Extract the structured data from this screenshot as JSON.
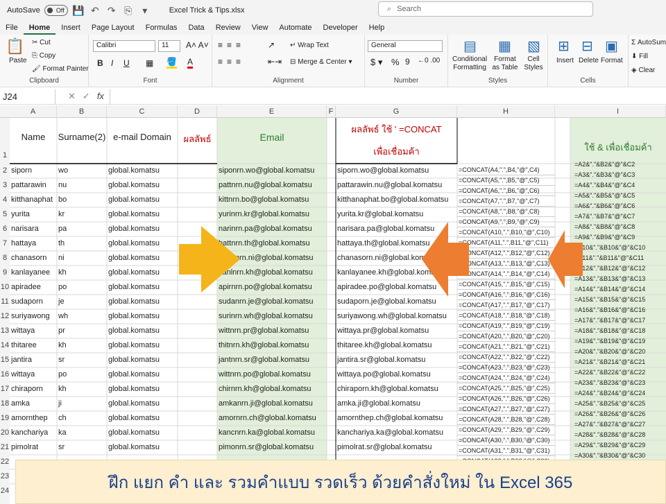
{
  "app": {
    "autosave_label": "AutoSave",
    "autosave_state": "Off",
    "filename": "Excel Trick & Tips.xlsx",
    "search_placeholder": "Search"
  },
  "tabs": [
    "File",
    "Home",
    "Insert",
    "Page Layout",
    "Formulas",
    "Data",
    "Review",
    "View",
    "Automate",
    "Developer",
    "Help"
  ],
  "ribbon": {
    "clipboard": {
      "label": "Clipboard",
      "paste": "Paste",
      "cut": "Cut",
      "copy": "Copy",
      "format_painter": "Format Painter"
    },
    "font": {
      "label": "Font",
      "name": "Calibri",
      "size": "11"
    },
    "alignment": {
      "label": "Alignment",
      "wrap": "Wrap Text",
      "merge": "Merge & Center"
    },
    "number": {
      "label": "Number",
      "format": "General"
    },
    "styles": {
      "label": "Styles",
      "cond": "Conditional Formatting",
      "table": "Format as Table",
      "cell": "Cell Styles"
    },
    "cells": {
      "label": "Cells",
      "insert": "Insert",
      "delete": "Delete",
      "format": "Format"
    },
    "editing": {
      "autosum": "AutoSum",
      "fill": "Fill",
      "clear": "Clear"
    }
  },
  "formula_bar": {
    "name_box": "J24",
    "fx": "fx"
  },
  "columns": [
    "A",
    "B",
    "C",
    "D",
    "E",
    "F",
    "G",
    "H",
    "I"
  ],
  "headers": {
    "a": "Name",
    "b": "Surname(2)",
    "c": "e-mail Domain",
    "d": "ผลลัพธ์",
    "e": "Email",
    "g1": "ผลลัพธ์ ใช้ ' =CONCAT",
    "g2": "เพื่อเชื่อมค้า",
    "i": "ใช้ & เพื่อเชื่อมค้า"
  },
  "rows": [
    {
      "n": "2",
      "a": "siporn",
      "b": "wo",
      "c": "global.komatsu",
      "e": "siponrn.wo@global.komatsu",
      "g": "siporn.wo@global.komatsu",
      "h": "=CONCAT(A4,\".\",B4,\"@\",C4)",
      "i": "=A2&\".\"&B2&\"@\"&C2"
    },
    {
      "n": "3",
      "a": "pattarawin",
      "b": "nu",
      "c": "global.komatsu",
      "e": "pattnrn.nu@global.komatsu",
      "g": "pattarawin.nu@global.komatsu",
      "h": "=CONCAT(A5,\".\",B5,\"@\",C5)",
      "i": "=A3&\".\"&B3&\"@\"&C3"
    },
    {
      "n": "4",
      "a": "kitthanaphat",
      "b": "bo",
      "c": "global.komatsu",
      "e": "kittnrn.bo@global.komatsu",
      "g": "kitthanaphat.bo@global.komatsu",
      "h": "=CONCAT(A6,\".\",B6,\"@\",C6)",
      "i": "=A4&\".\"&B4&\"@\"&C4"
    },
    {
      "n": "5",
      "a": "yurita",
      "b": "kr",
      "c": "global.komatsu",
      "e": "yurinrn.kr@global.komatsu",
      "g": "yurita.kr@global.komatsu",
      "h": "=CONCAT(A7,\".\",B7,\"@\",C7)",
      "i": "=A5&\".\"&B5&\"@\"&C5"
    },
    {
      "n": "6",
      "a": "narisara",
      "b": "pa",
      "c": "global.komatsu",
      "e": "narinrn.pa@global.komatsu",
      "g": "narisara.pa@global.komatsu",
      "h": "=CONCAT(A8,\".\",B8,\"@\",C8)",
      "i": "=A6&\".\"&B6&\"@\"&C6"
    },
    {
      "n": "7",
      "a": "hattaya",
      "b": "th",
      "c": "global.komatsu",
      "e": "hattnrn.th@global.komatsu",
      "g": "hattaya.th@global.komatsu",
      "h": "=CONCAT(A9,\".\",B9,\"@\",C9)",
      "i": "=A7&\".\"&B7&\"@\"&C7"
    },
    {
      "n": "8",
      "a": "chanasorn",
      "b": "ni",
      "c": "global.komatsu",
      "e": "channrn.ni@global.komatsu",
      "g": "chanasorn.ni@global.komatsu",
      "h": "=CONCAT(A10,\".\",B10,\"@\",C10)",
      "i": "=A8&\".\"&B8&\"@\"&C8"
    },
    {
      "n": "9",
      "a": "kanlayanee",
      "b": "kh",
      "c": "global.komatsu",
      "e": "kanlnrn.kh@global.komatsu",
      "g": "kanlayanee.kh@global.komatsu",
      "h": "=CONCAT(A11,\".\",B11,\"@\",C11)",
      "i": "=A9&\".\"&B9&\"@\"&C9"
    },
    {
      "n": "10",
      "a": "apiradee",
      "b": "po",
      "c": "global.komatsu",
      "e": "apirnrn.po@global.komatsu",
      "g": "apiradee.po@global.komatsu",
      "h": "=CONCAT(A12,\".\",B12,\"@\",C12)",
      "i": "=A10&\".\"&B10&\"@\"&C10"
    },
    {
      "n": "11",
      "a": "sudaporn",
      "b": "je",
      "c": "global.komatsu",
      "e": "sudanrn.je@global.komatsu",
      "g": "sudaporn.je@global.komatsu",
      "h": "=CONCAT(A13,\".\",B13,\"@\",C13)",
      "i": "=A11&\".\"&B11&\"@\"&C11"
    },
    {
      "n": "12",
      "a": "suriyawong",
      "b": "wh",
      "c": "global.komatsu",
      "e": "surinrn.wh@global.komatsu",
      "g": "suriyawong.wh@global.komatsu",
      "h": "=CONCAT(A14,\".\",B14,\"@\",C14)",
      "i": "=A12&\".\"&B12&\"@\"&C12"
    },
    {
      "n": "13",
      "a": "wittaya",
      "b": "pr",
      "c": "global.komatsu",
      "e": "wittnrn.pr@global.komatsu",
      "g": "wittaya.pr@global.komatsu",
      "h": "=CONCAT(A15,\".\",B15,\"@\",C15)",
      "i": "=A13&\".\"&B13&\"@\"&C13"
    },
    {
      "n": "14",
      "a": "thitaree",
      "b": "kh",
      "c": "global.komatsu",
      "e": "thitnrn.kh@global.komatsu",
      "g": "thitaree.kh@global.komatsu",
      "h": "=CONCAT(A16,\".\",B16,\"@\",C16)",
      "i": "=A14&\".\"&B14&\"@\"&C14"
    },
    {
      "n": "15",
      "a": "jantira",
      "b": "sr",
      "c": "global.komatsu",
      "e": "jantnrn.sr@global.komatsu",
      "g": "jantira.sr@global.komatsu",
      "h": "=CONCAT(A17,\".\",B17,\"@\",C17)",
      "i": "=A15&\".\"&B15&\"@\"&C15"
    },
    {
      "n": "16",
      "a": "wittaya",
      "b": "po",
      "c": "global.komatsu",
      "e": "wittnrn.po@global.komatsu",
      "g": "wittaya.po@global.komatsu",
      "h": "=CONCAT(A18,\".\",B18,\"@\",C18)",
      "i": "=A16&\".\"&B16&\"@\"&C16"
    },
    {
      "n": "17",
      "a": "chiraporn",
      "b": "kh",
      "c": "global.komatsu",
      "e": "chirnrn.kh@global.komatsu",
      "g": "chiraporn.kh@global.komatsu",
      "h": "=CONCAT(A19,\".\",B19,\"@\",C19)",
      "i": "=A17&\".\"&B17&\"@\"&C17"
    },
    {
      "n": "18",
      "a": "amka",
      "b": "ji",
      "c": "global.komatsu",
      "e": "amkanrn.ji@global.komatsu",
      "g": "amka.ji@global.komatsu",
      "h": "=CONCAT(A20,\".\",B20,\"@\",C20)",
      "i": "=A18&\".\"&B18&\"@\"&C18"
    },
    {
      "n": "19",
      "a": "amornthep",
      "b": "ch",
      "c": "global.komatsu",
      "e": "amornrn.ch@global.komatsu",
      "g": "amornthep.ch@global.komatsu",
      "h": "=CONCAT(A21,\".\",B21,\"@\",C21)",
      "i": "=A19&\".\"&B19&\"@\"&C19"
    },
    {
      "n": "20",
      "a": "kanchariya",
      "b": "ka",
      "c": "global.komatsu",
      "e": "kancnrn.ka@global.komatsu",
      "g": "kanchariya.ka@global.komatsu",
      "h": "=CONCAT(A22,\".\",B22,\"@\",C22)",
      "i": "=A20&\".\"&B20&\"@\"&C20"
    },
    {
      "n": "21",
      "a": "pimolrat",
      "b": "sr",
      "c": "global.komatsu",
      "e": "pimonrn.sr@global.komatsu",
      "g": "pimolrat.sr@global.komatsu",
      "h": "=CONCAT(A23,\".\",B23,\"@\",C23)",
      "i": "=A21&\".\"&B21&\"@\"&C21"
    }
  ],
  "extra_h": [
    "=CONCAT(A24,\".\",B24,\"@\",C24)",
    "=CONCAT(A25,\".\",B25,\"@\",C25)",
    "=CONCAT(A26,\".\",B26,\"@\",C26)",
    "=CONCAT(A27,\".\",B27,\"@\",C27)",
    "=CONCAT(A28,\".\",B28,\"@\",C28)",
    "=CONCAT(A29,\".\",B29,\"@\",C29)",
    "=CONCAT(A30,\".\",B30,\"@\",C30)",
    "=CONCAT(A31,\".\",B31,\"@\",C31)",
    "=CONCAT(A32,\".\",B32,\"@\",C32)"
  ],
  "extra_i": [
    "=A22&\".\"&B22&\"@\"&C22",
    "=A23&\".\"&B23&\"@\"&C23",
    "=A24&\".\"&B24&\"@\"&C24",
    "=A25&\".\"&B25&\"@\"&C25",
    "=A26&\".\"&B26&\"@\"&C26",
    "=A27&\".\"&B27&\"@\"&C27",
    "=A28&\".\"&B28&\"@\"&C28",
    "=A29&\".\"&B29&\"@\"&C29",
    "=A30&\".\"&B30&\"@\"&C30"
  ],
  "tail_rows": [
    "22",
    "23",
    "24"
  ],
  "banner": "ฝึก แยก คำ และ รวมคำแบบ รวดเร็ว ด้วยคำสั่งใหม่ ใน Excel 365",
  "colors": {
    "green_fill": "#e2efda",
    "red_text": "#c00000",
    "green_text": "#2d7d2d",
    "arrow_yellow": "#f4b41a",
    "arrow_orange": "#ed7d31"
  }
}
